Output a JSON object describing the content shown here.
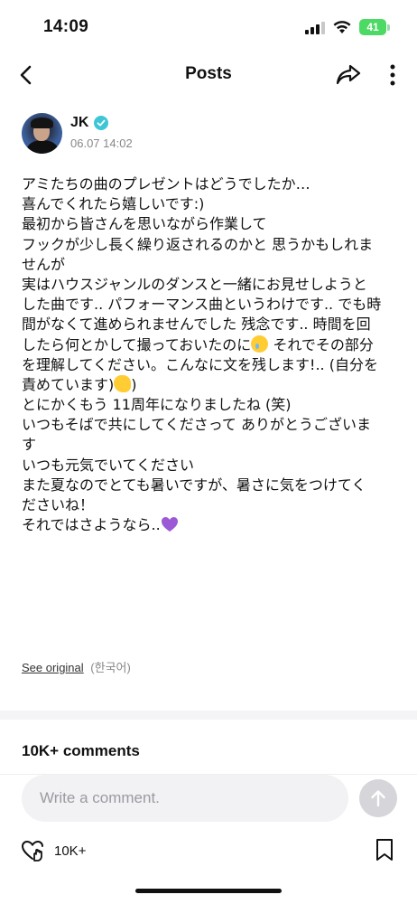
{
  "status": {
    "time": "14:09",
    "battery": "41"
  },
  "nav": {
    "title": "Posts"
  },
  "author": {
    "name": "JK",
    "timestamp": "06.07 14:02"
  },
  "post": {
    "lines": [
      "アミたちの曲のプレゼントはどうでしたか…",
      "喜んでくれたら嬉しいです:)",
      "最初から皆さんを思いながら作業して",
      "フックが少し長く繰り返されるのかと 思うかもしれま",
      "せんが",
      "実はハウスジャンルのダンスと一緒にお見せしようと",
      "した曲です.. パフォーマンス曲というわけです.. でも時",
      "間がなくて進められませんでした 残念です.. 時間を回",
      "したら何とかして撮っておいたのに",
      " それでその部分",
      "を理解してください。こんなに文を残します!.. (自分を",
      "責めています)",
      ")",
      "とにかくもう 11周年になりましたね (笑)",
      "いつもそばで共にしてくださって ありがとうございま",
      "す",
      "いつも元気でいてください",
      "また夏なのでとても暑いですが、暑さに気をつけてく",
      "ださいね！",
      "それではさようなら.."
    ],
    "emoji": [
      "crying-face",
      "melting-face",
      "purple-heart"
    ]
  },
  "translation": {
    "see_original": "See original",
    "language": "(한국어)"
  },
  "comments": {
    "title": "10K+ comments",
    "placeholder": "Write a comment.",
    "like_count": "10K+"
  },
  "colors": {
    "verified": "#3ec6d6",
    "battery": "#4cd964",
    "heart": "#9b59d6"
  }
}
